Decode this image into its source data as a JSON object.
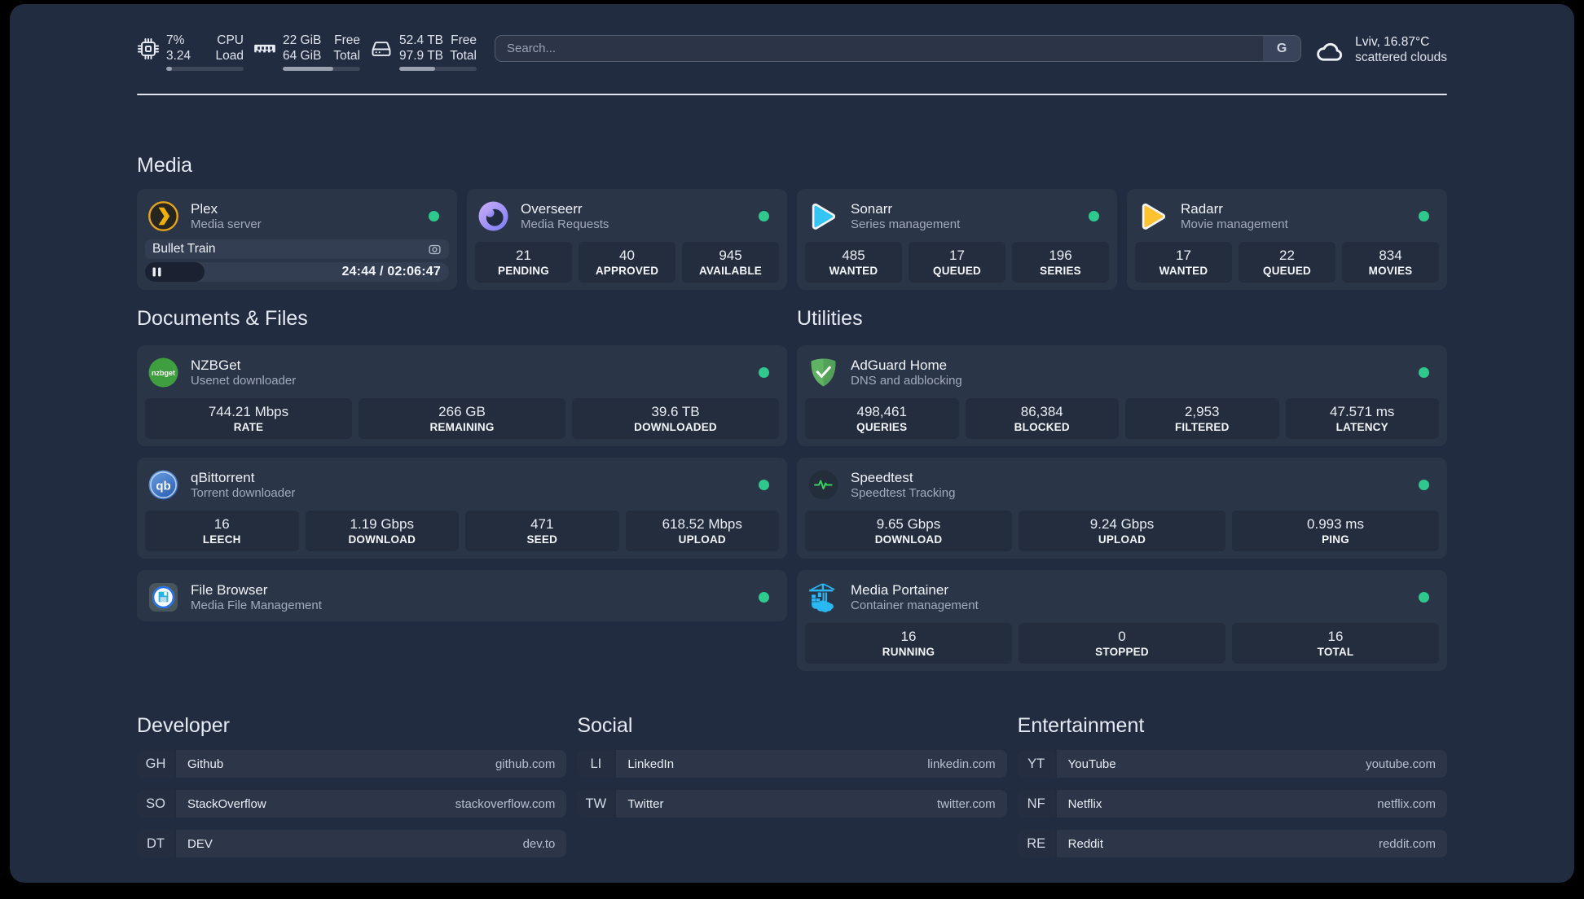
{
  "meta": {
    "theme_background": "#222c40",
    "card_background": "#2b3548",
    "status_color": "#2fc98e"
  },
  "header": {
    "cpu": {
      "icon": "cpu-icon",
      "value1": "7%",
      "label1": "CPU",
      "value2": "3.24",
      "label2": "Load",
      "used_percent": 7
    },
    "memory": {
      "icon": "memory-icon",
      "value1": "22 GiB",
      "label1": "Free",
      "value2": "64 GiB",
      "label2": "Total",
      "used_percent": 65
    },
    "disk": {
      "icon": "disk-icon",
      "value1": "52.4 TB",
      "label1": "Free",
      "value2": "97.9 TB",
      "label2": "Total",
      "used_percent": 46
    },
    "search": {
      "placeholder": "Search...",
      "button": "G"
    },
    "weather": {
      "icon": "cloud-icon",
      "line1": "Lviv, 16.87°C",
      "line2": "scattered clouds"
    }
  },
  "media": {
    "title": "Media",
    "plex": {
      "title": "Plex",
      "subtitle": "Media server",
      "status": "online",
      "now_playing": "Bullet Train",
      "time": "24:44 / 02:06:47",
      "progress_percent": 19.5
    },
    "overseerr": {
      "title": "Overseerr",
      "subtitle": "Media Requests",
      "status": "online",
      "stats": [
        {
          "value": "21",
          "label": "PENDING"
        },
        {
          "value": "40",
          "label": "APPROVED"
        },
        {
          "value": "945",
          "label": "AVAILABLE"
        }
      ]
    },
    "sonarr": {
      "title": "Sonarr",
      "subtitle": "Series management",
      "status": "online",
      "stats": [
        {
          "value": "485",
          "label": "WANTED"
        },
        {
          "value": "17",
          "label": "QUEUED"
        },
        {
          "value": "196",
          "label": "SERIES"
        }
      ]
    },
    "radarr": {
      "title": "Radarr",
      "subtitle": "Movie management",
      "status": "online",
      "stats": [
        {
          "value": "17",
          "label": "WANTED"
        },
        {
          "value": "22",
          "label": "QUEUED"
        },
        {
          "value": "834",
          "label": "MOVIES"
        }
      ]
    }
  },
  "documents": {
    "title": "Documents & Files",
    "nzbget": {
      "title": "NZBGet",
      "subtitle": "Usenet downloader",
      "status": "online",
      "stats": [
        {
          "value": "744.21 Mbps",
          "label": "RATE"
        },
        {
          "value": "266 GB",
          "label": "REMAINING"
        },
        {
          "value": "39.6 TB",
          "label": "DOWNLOADED"
        }
      ]
    },
    "qbittorrent": {
      "title": "qBittorrent",
      "subtitle": "Torrent downloader",
      "status": "online",
      "stats": [
        {
          "value": "16",
          "label": "LEECH"
        },
        {
          "value": "1.19 Gbps",
          "label": "DOWNLOAD"
        },
        {
          "value": "471",
          "label": "SEED"
        },
        {
          "value": "618.52 Mbps",
          "label": "UPLOAD"
        }
      ]
    },
    "filebrowser": {
      "title": "File Browser",
      "subtitle": "Media File Management",
      "status": "online"
    }
  },
  "utilities": {
    "title": "Utilities",
    "adguard": {
      "title": "AdGuard Home",
      "subtitle": "DNS and adblocking",
      "status": "online",
      "stats": [
        {
          "value": "498,461",
          "label": "QUERIES"
        },
        {
          "value": "86,384",
          "label": "BLOCKED"
        },
        {
          "value": "2,953",
          "label": "FILTERED"
        },
        {
          "value": "47.571 ms",
          "label": "LATENCY"
        }
      ]
    },
    "speedtest": {
      "title": "Speedtest",
      "subtitle": "Speedtest Tracking",
      "status": "online",
      "stats": [
        {
          "value": "9.65 Gbps",
          "label": "DOWNLOAD"
        },
        {
          "value": "9.24 Gbps",
          "label": "UPLOAD"
        },
        {
          "value": "0.993 ms",
          "label": "PING"
        }
      ]
    },
    "portainer": {
      "title": "Media Portainer",
      "subtitle": "Container management",
      "status": "online",
      "stats": [
        {
          "value": "16",
          "label": "RUNNING"
        },
        {
          "value": "0",
          "label": "STOPPED"
        },
        {
          "value": "16",
          "label": "TOTAL"
        }
      ]
    }
  },
  "bookmarks": {
    "developer": {
      "title": "Developer",
      "items": [
        {
          "abbr": "GH",
          "name": "Github",
          "url": "github.com"
        },
        {
          "abbr": "SO",
          "name": "StackOverflow",
          "url": "stackoverflow.com"
        },
        {
          "abbr": "DT",
          "name": "DEV",
          "url": "dev.to"
        }
      ]
    },
    "social": {
      "title": "Social",
      "items": [
        {
          "abbr": "LI",
          "name": "LinkedIn",
          "url": "linkedin.com"
        },
        {
          "abbr": "TW",
          "name": "Twitter",
          "url": "twitter.com"
        }
      ]
    },
    "entertainment": {
      "title": "Entertainment",
      "items": [
        {
          "abbr": "YT",
          "name": "YouTube",
          "url": "youtube.com"
        },
        {
          "abbr": "NF",
          "name": "Netflix",
          "url": "netflix.com"
        },
        {
          "abbr": "RE",
          "name": "Reddit",
          "url": "reddit.com"
        }
      ]
    }
  }
}
